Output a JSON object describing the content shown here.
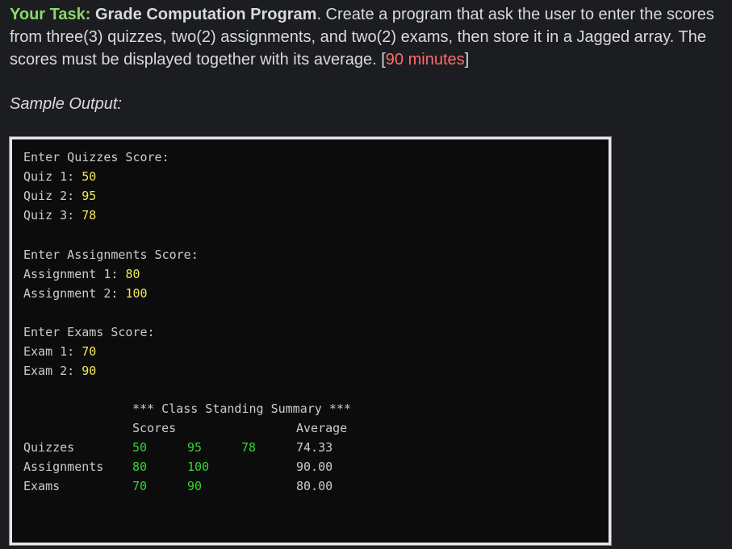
{
  "task": {
    "label": "Your Task:",
    "program_name": "Grade Computation Program",
    "text_1": ". Create a program that ask the user to enter the scores from three(3) quizzes, two(2) assignments, and two(2) exams, then store it in a Jagged array. The scores must be displayed together with its average. [",
    "duration": "90 minutes",
    "text_2": "]"
  },
  "sample_heading": "Sample Output:",
  "console": {
    "quizzes_prompt": "Enter Quizzes Score:",
    "quiz1_label": "Quiz 1: ",
    "quiz1_value": "50",
    "quiz2_label": "Quiz 2: ",
    "quiz2_value": "95",
    "quiz3_label": "Quiz 3: ",
    "quiz3_value": "78",
    "assignments_prompt": "Enter Assignments Score:",
    "assign1_label": "Assignment 1: ",
    "assign1_value": "80",
    "assign2_label": "Assignment 2: ",
    "assign2_value": "100",
    "exams_prompt": "Enter Exams Score:",
    "exam1_label": "Exam 1: ",
    "exam1_value": "70",
    "exam2_label": "Exam 2: ",
    "exam2_value": "90",
    "summary_title": "*** Class Standing Summary ***",
    "scores_header": "Scores",
    "average_header": "Average",
    "rows": [
      {
        "name": "Quizzes",
        "scores": [
          "50",
          "95",
          "78"
        ],
        "average": "74.33"
      },
      {
        "name": "Assignments",
        "scores": [
          "80",
          "100"
        ],
        "average": "90.00"
      },
      {
        "name": "Exams",
        "scores": [
          "70",
          "90"
        ],
        "average": "80.00"
      }
    ]
  }
}
